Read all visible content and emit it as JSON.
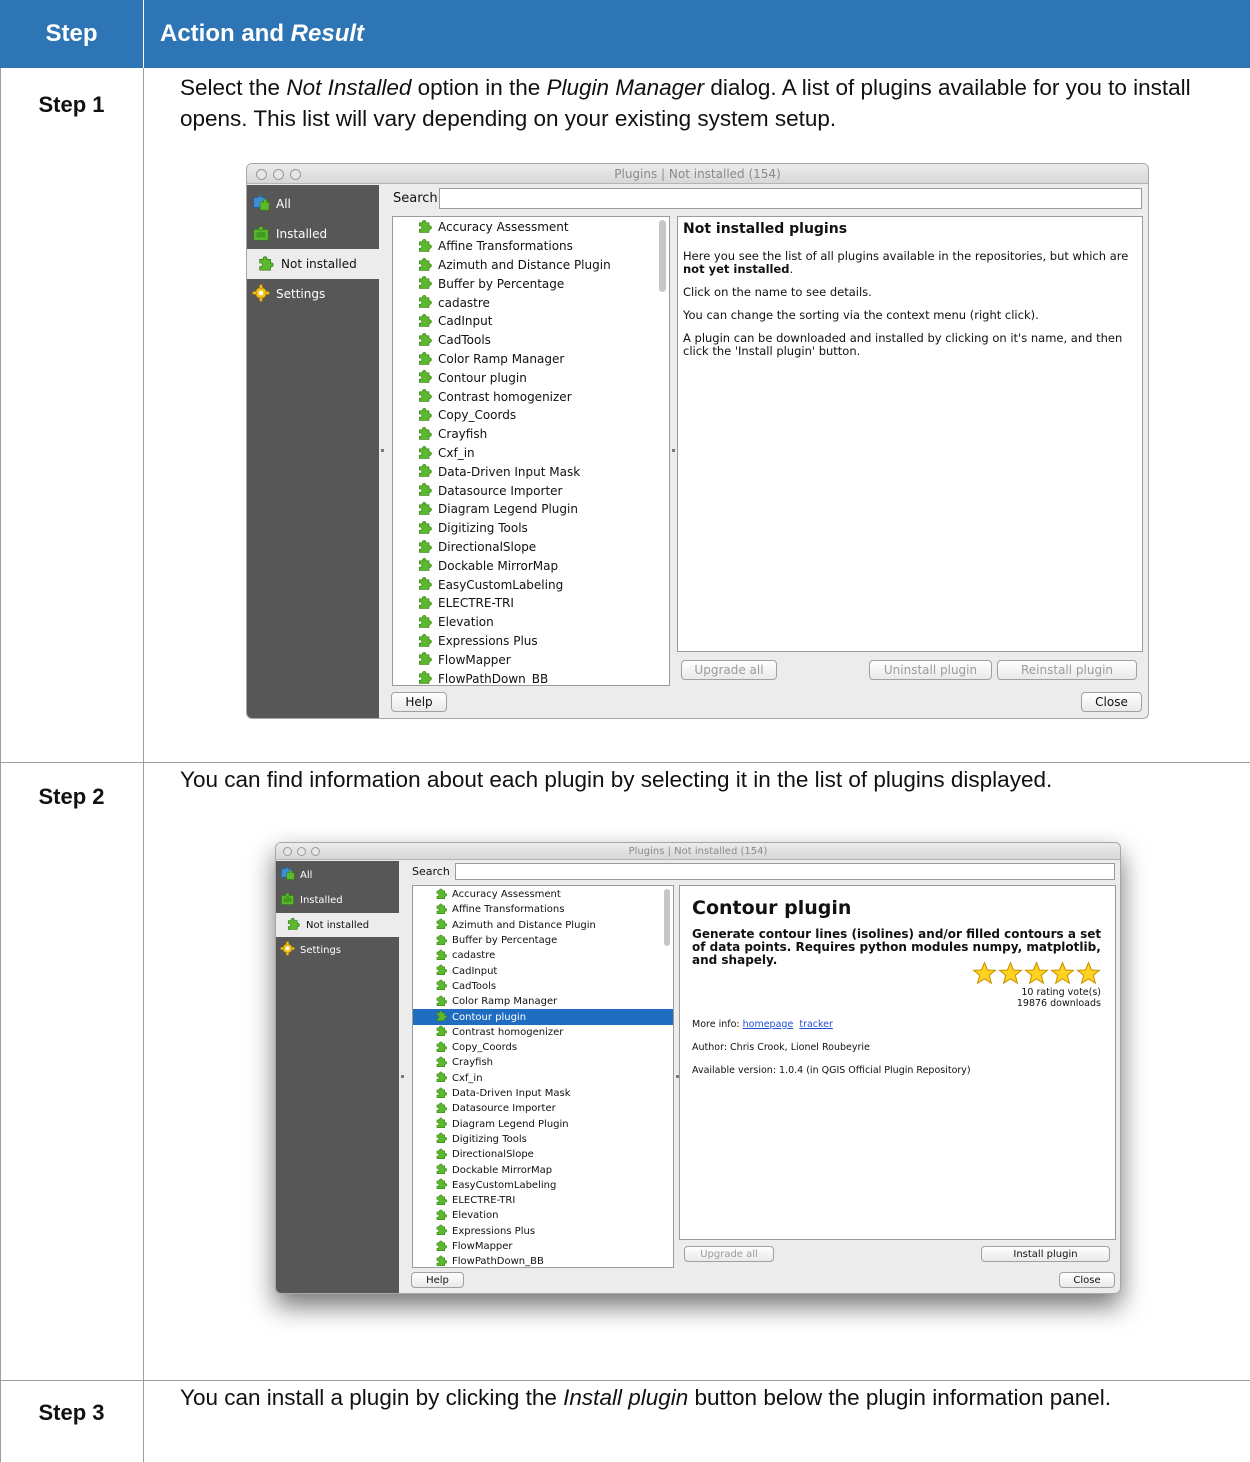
{
  "header": {
    "step": "Step",
    "action_pre": "Action and ",
    "action_italic": "Result"
  },
  "steps": [
    {
      "label": "Step 1",
      "text_a": "Select the ",
      "text_b": "Not Installed",
      "text_c": " option in the ",
      "text_d": "Plugin Manager",
      "text_e": " dialog. A list of plugins available for you to install opens. This list will vary depending on your existing system setup."
    },
    {
      "label": "Step 2",
      "text": "You can find information about each plugin by selecting it in the list of plugins displayed."
    },
    {
      "label": "Step 3",
      "text_a": "You can install a plugin by clicking the ",
      "text_b": "Install plugin",
      "text_c": " button below the plugin information panel."
    }
  ],
  "window1": {
    "title": "Plugins | Not installed (154)",
    "sidebar": [
      "All",
      "Installed",
      "Not installed",
      "Settings"
    ],
    "search_label": "Search",
    "info_title": "Not installed plugins",
    "info_p1a": "Here you see the list of all plugins available in the repositories, but which are ",
    "info_p1b": "not yet installed",
    "info_p1c": ".",
    "info_p2": "Click on the name to see details.",
    "info_p3": "You can change the sorting via the context menu (right click).",
    "info_p4": "A plugin can be downloaded and installed by clicking on it's name, and then click the 'Install plugin' button.",
    "btn_upgrade": "Upgrade all",
    "btn_uninstall": "Uninstall plugin",
    "btn_reinstall": "Reinstall plugin",
    "btn_help": "Help",
    "btn_close": "Close"
  },
  "window2": {
    "title": "Plugins | Not installed (154)",
    "sidebar": [
      "All",
      "Installed",
      "Not installed",
      "Settings"
    ],
    "search_label": "Search",
    "selected_index": 8,
    "info_title": "Contour plugin",
    "info_desc": "Generate contour lines (isolines) and/or filled contours a set of data points. Requires python modules numpy, matplotlib, and shapely.",
    "rating_stars": 5,
    "rating_votes": "10 rating vote(s)",
    "downloads": "19876 downloads",
    "more_info_label": "More info:",
    "link_homepage": "homepage",
    "link_tracker": "tracker",
    "author": "Author: Chris Crook, Lionel Roubeyrie",
    "version": "Available version: 1.0.4 (in QGIS Official Plugin Repository)",
    "btn_upgrade": "Upgrade all",
    "btn_install": "Install plugin",
    "btn_help": "Help",
    "btn_close": "Close"
  },
  "plugins": [
    "Accuracy Assessment",
    "Affine Transformations",
    "Azimuth and Distance Plugin",
    "Buffer by Percentage",
    "cadastre",
    "CadInput",
    "CadTools",
    "Color Ramp Manager",
    "Contour plugin",
    "Contrast homogenizer",
    "Copy_Coords",
    "Crayfish",
    "Cxf_in",
    "Data-Driven Input Mask",
    "Datasource Importer",
    "Diagram Legend Plugin",
    "Digitizing Tools",
    "DirectionalSlope",
    "Dockable MirrorMap",
    "EasyCustomLabeling",
    "ELECTRE-TRI",
    "Elevation",
    "Expressions Plus",
    "FlowMapper",
    "FlowPathDown_BB"
  ],
  "colors": {
    "header_bg": "#2e75b6",
    "sidebar_bg": "#575757",
    "selection": "#1f6cc1",
    "puzzle_green": "#5cb82c"
  }
}
